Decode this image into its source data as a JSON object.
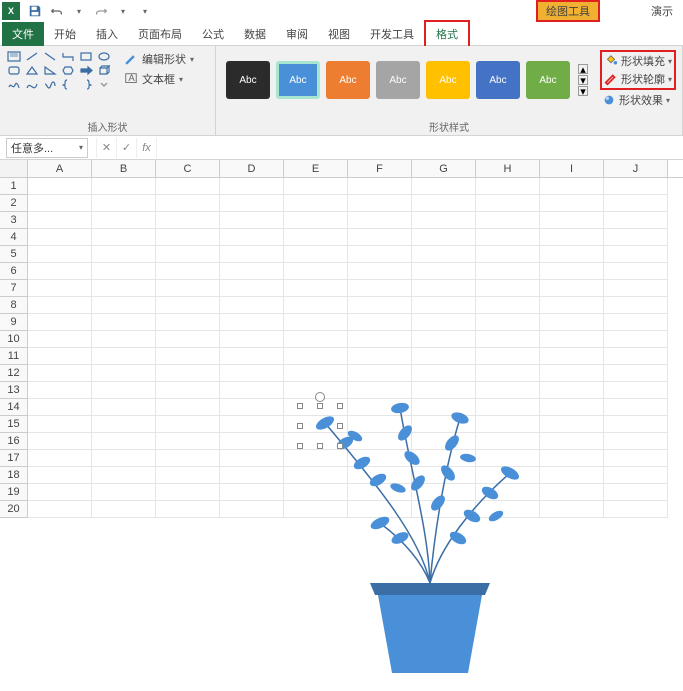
{
  "titlebar": {
    "app_abbrev": "X",
    "tool_context": "绘图工具",
    "presentation": "演示"
  },
  "tabs": {
    "file": "文件",
    "home": "开始",
    "insert": "插入",
    "page_layout": "页面布局",
    "formulas": "公式",
    "data": "数据",
    "review": "审阅",
    "view": "视图",
    "developer": "开发工具",
    "format": "格式"
  },
  "ribbon": {
    "insert_shapes": {
      "label": "插入形状",
      "edit_shape": "编辑形状",
      "text_box": "文本框"
    },
    "shape_styles": {
      "label": "形状样式",
      "swatch_text": "Abc",
      "shape_fill": "形状填充",
      "shape_outline": "形状轮廓",
      "shape_effects": "形状效果"
    }
  },
  "formula_bar": {
    "namebox": "任意多...",
    "fx": "fx"
  },
  "grid": {
    "columns": [
      "A",
      "B",
      "C",
      "D",
      "E",
      "F",
      "G",
      "H",
      "I",
      "J"
    ],
    "rows": [
      "1",
      "2",
      "3",
      "4",
      "5",
      "6",
      "7",
      "8",
      "9",
      "10",
      "11",
      "12",
      "13",
      "14",
      "15",
      "16",
      "17",
      "18",
      "19",
      "20"
    ]
  }
}
